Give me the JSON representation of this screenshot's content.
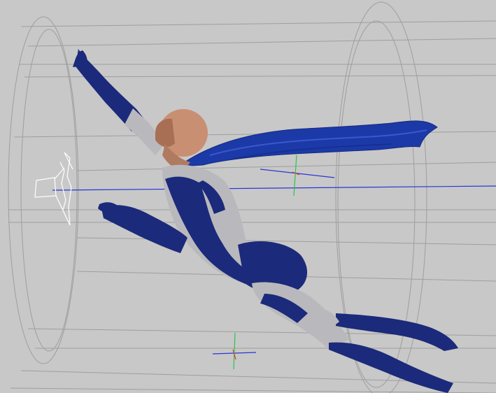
{
  "viewport": {
    "background_color": "#c8c8c8",
    "grid_line_color": "#9a9a9a",
    "axis_x_color": "#2b35d6",
    "axis_y_color": "#27c64a",
    "axis_z_color": "#d63a2b",
    "camera_wireframe_color": "#ffffff"
  },
  "figure": {
    "suit_primary_color": "#1b2a7a",
    "suit_secondary_color": "#b9b9bd",
    "skin_color": "#c98f73",
    "cape_color": "#1c39a8"
  },
  "icons": [
    "camera-icon",
    "transform-gizmo-icon",
    "cylinder-wireframe-icon"
  ]
}
